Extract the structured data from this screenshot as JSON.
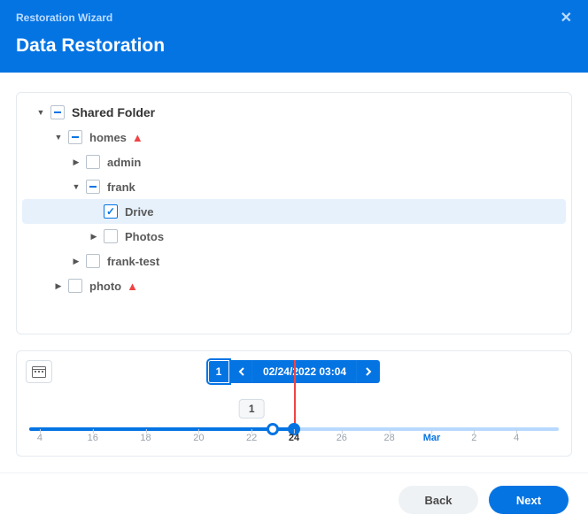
{
  "dialog": {
    "window_title": "Restoration Wizard",
    "heading": "Data Restoration"
  },
  "tree": {
    "root": {
      "label": "Shared Folder",
      "state": "partial",
      "expanded": true
    },
    "homes": {
      "label": "homes",
      "state": "partial",
      "expanded": true,
      "warning": true
    },
    "admin": {
      "label": "admin",
      "state": "unchecked",
      "expanded": false
    },
    "frank": {
      "label": "frank",
      "state": "partial",
      "expanded": true
    },
    "drive": {
      "label": "Drive",
      "state": "checked",
      "selected": true
    },
    "photos": {
      "label": "Photos",
      "state": "unchecked",
      "expanded": false
    },
    "frank_test": {
      "label": "frank-test",
      "state": "unchecked",
      "expanded": false
    },
    "photo": {
      "label": "photo",
      "state": "unchecked",
      "expanded": false,
      "warning": true
    }
  },
  "timeline": {
    "snapshot_count": "1",
    "selected_datetime": "02/24/2022 03:04",
    "marker_badge": "1",
    "ticks": [
      {
        "label": "4",
        "pos_pct": 2
      },
      {
        "label": "16",
        "pos_pct": 12
      },
      {
        "label": "18",
        "pos_pct": 22
      },
      {
        "label": "20",
        "pos_pct": 32
      },
      {
        "label": "22",
        "pos_pct": 42
      },
      {
        "label": "24",
        "pos_pct": 50,
        "current": true
      },
      {
        "label": "26",
        "pos_pct": 59
      },
      {
        "label": "28",
        "pos_pct": 68
      },
      {
        "label": "Mar",
        "pos_pct": 76,
        "month": true
      },
      {
        "label": "2",
        "pos_pct": 84
      },
      {
        "label": "4",
        "pos_pct": 92
      }
    ]
  },
  "footer": {
    "back": "Back",
    "next": "Next"
  }
}
